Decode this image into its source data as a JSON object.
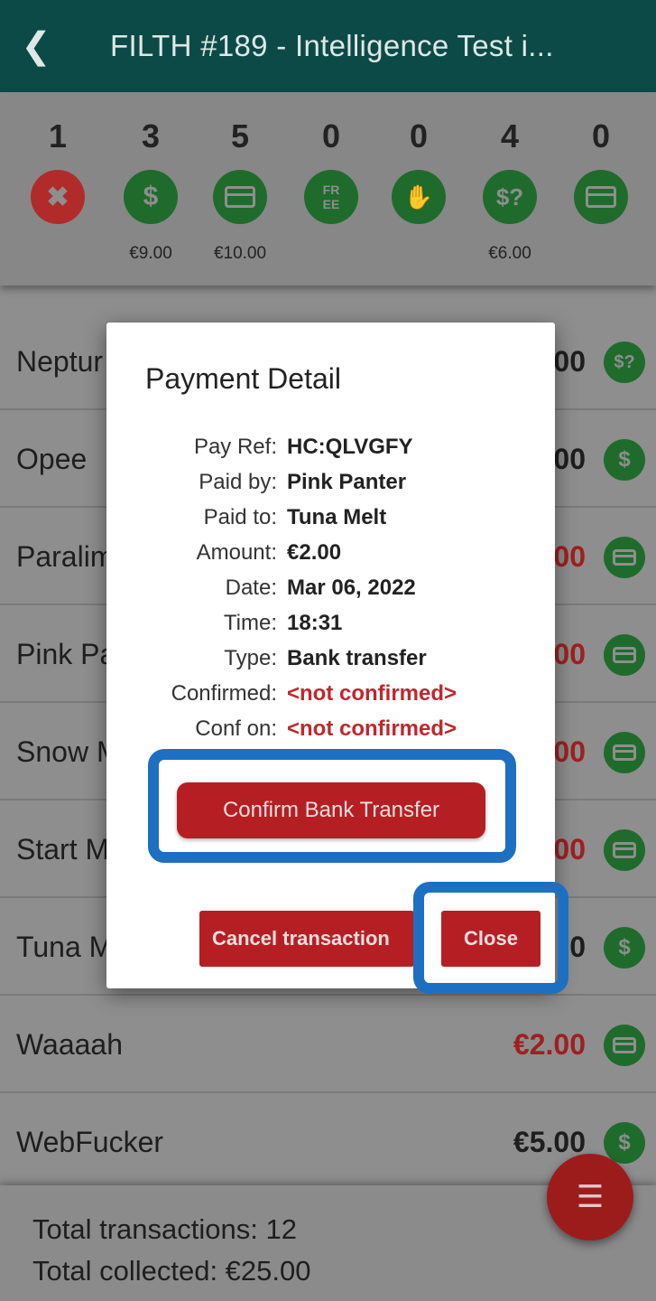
{
  "header": {
    "back_icon": "chevron-left-icon",
    "title": "FILTH #189 - Intelligence Test i..."
  },
  "summary": [
    {
      "count": "1",
      "icon": "cancelled-icon",
      "amount": ""
    },
    {
      "count": "3",
      "icon": "cash-icon",
      "amount": "€9.00"
    },
    {
      "count": "5",
      "icon": "card-icon",
      "amount": "€10.00"
    },
    {
      "count": "0",
      "icon": "free-icon",
      "amount": ""
    },
    {
      "count": "0",
      "icon": "hand-money-icon",
      "amount": ""
    },
    {
      "count": "4",
      "icon": "cash-unconfirmed-icon",
      "amount": "€6.00"
    },
    {
      "count": "0",
      "icon": "card-unconfirmed-icon",
      "amount": ""
    }
  ],
  "rows": [
    {
      "name": "Neptur",
      "amount": "00",
      "icon": "cash-unconfirmed-icon"
    },
    {
      "name": "Opee",
      "amount": "00",
      "icon": "cash-icon"
    },
    {
      "name": "Paralim",
      "amount": "00",
      "icon": "card-icon"
    },
    {
      "name": "Pink Pa",
      "amount": "00",
      "icon": "card-icon"
    },
    {
      "name": "Snow M",
      "amount": "00",
      "icon": "card-icon"
    },
    {
      "name": "Start M",
      "amount": "00",
      "icon": "card-icon"
    },
    {
      "name": "Tuna M",
      "amount": "0",
      "icon": "cash-icon"
    },
    {
      "name": "Waaaah",
      "amount": "€2.00",
      "icon": "card-icon"
    },
    {
      "name": "WebFucker",
      "amount": "€5.00",
      "icon": "cash-icon"
    }
  ],
  "footer": {
    "total_transactions": "Total transactions: 12",
    "total_collected": "Total collected: €25.00"
  },
  "fab_icon": "menu-icon",
  "modal": {
    "title": "Payment Detail",
    "details": [
      {
        "label": "Pay Ref:",
        "value": "HC:QLVGFY"
      },
      {
        "label": "Paid by:",
        "value": "Pink Panter"
      },
      {
        "label": "Paid to:",
        "value": "Tuna Melt"
      },
      {
        "label": "Amount:",
        "value": "€2.00"
      },
      {
        "label": "Date:",
        "value": "Mar 06, 2022"
      },
      {
        "label": "Time:",
        "value": "18:31"
      },
      {
        "label": "Type:",
        "value": "Bank transfer"
      },
      {
        "label": "Confirmed:",
        "value": "<not confirmed>"
      },
      {
        "label": "Conf on:",
        "value": "<not confirmed>"
      }
    ],
    "confirm_label": "Confirm Bank Transfer",
    "cancel_label": "Cancel transaction",
    "close_label": "Close"
  },
  "colors": {
    "header_bg": "#0c4a47",
    "green_icon": "#1f6b2c",
    "red_button": "#b51f24",
    "alert_text": "#c0272d",
    "highlight": "#1d6fc2"
  }
}
